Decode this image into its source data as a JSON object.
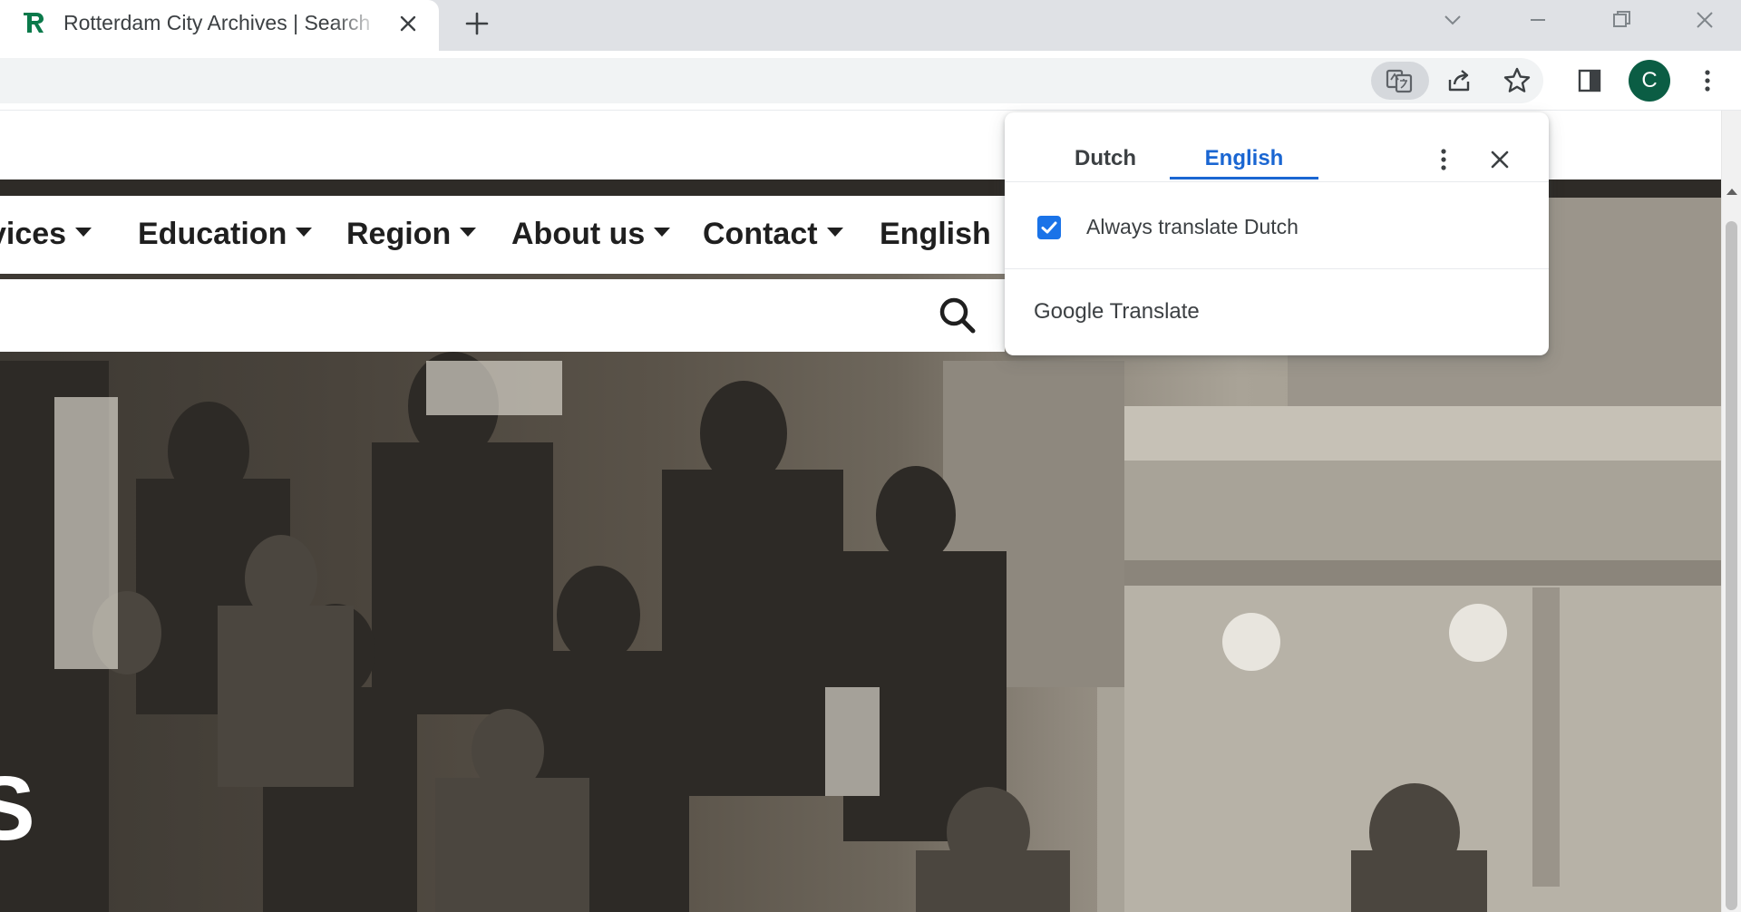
{
  "browser": {
    "tab": {
      "title": "Rotterdam City Archives | Search"
    },
    "profile_initial": "C",
    "colors": {
      "tabstrip": "#dfe1e5",
      "avatar": "#0b5d44",
      "brand_green": "#0b7a4b"
    },
    "icons": [
      "favicon-r-icon",
      "close-icon",
      "plus-icon",
      "chevron-down-icon",
      "minimize-icon",
      "restore-icon",
      "window-close-icon",
      "translate-icon",
      "share-icon",
      "star-icon",
      "side-panel-icon",
      "kebab-menu-icon"
    ]
  },
  "site": {
    "nav": {
      "services": "vices",
      "education": "Education",
      "region": "Region",
      "about": "About us",
      "contact": "Contact",
      "language": "English"
    },
    "search": {
      "value": "",
      "placeholder": ""
    },
    "hero_letter": "S"
  },
  "translate_popup": {
    "source_lang": "Dutch",
    "target_lang": "English",
    "selected": "English",
    "always_translate": {
      "label": "Always translate Dutch",
      "checked": true
    },
    "footer": "Google Translate",
    "accent": "#1a73e8"
  }
}
